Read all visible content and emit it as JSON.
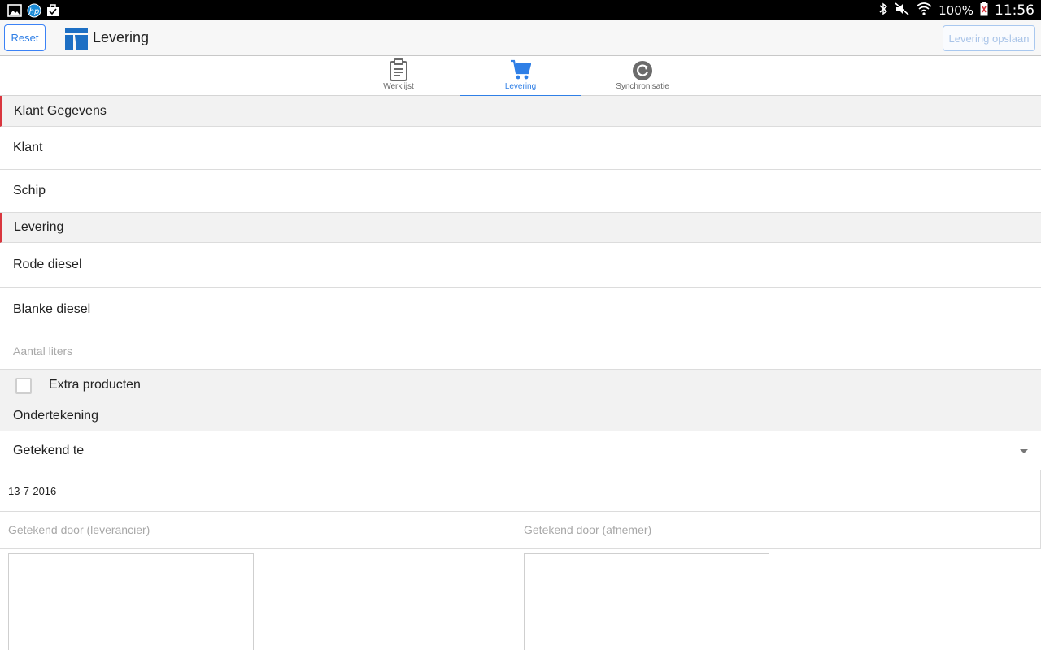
{
  "status_bar": {
    "icons_left": [
      "image-icon",
      "hp-icon",
      "briefcase-icon"
    ],
    "icons_right": [
      "bluetooth-icon",
      "mute-icon",
      "wifi-icon",
      "battery-icon"
    ],
    "battery_percent": "100%",
    "time": "11:56"
  },
  "app_bar": {
    "reset_label": "Reset",
    "title": "Levering",
    "save_label": "Levering opslaan"
  },
  "tabs": [
    {
      "label": "Werklijst",
      "icon": "clipboard-icon",
      "active": false
    },
    {
      "label": "Levering",
      "icon": "cart-icon",
      "active": true
    },
    {
      "label": "Synchronisatie",
      "icon": "sync-icon",
      "active": false
    }
  ],
  "form": {
    "klant_section": "Klant Gegevens",
    "klant": "Klant",
    "schip": "Schip",
    "levering_section": "Levering",
    "rode_diesel": "Rode diesel",
    "blanke_diesel": "Blanke diesel",
    "aantal_liters_placeholder": "Aantal liters",
    "extra_producten": "Extra producten",
    "ondertekening_section": "Ondertekening",
    "getekend_te": "Getekend te",
    "datum": "13-7-2016",
    "getekend_door_leverancier": "Getekend door (leverancier)",
    "getekend_door_afnemer": "Getekend door (afnemer)"
  },
  "colors": {
    "accent": "#2f7fe6",
    "section_marker": "#d9363e",
    "status_bar": "#000000"
  }
}
